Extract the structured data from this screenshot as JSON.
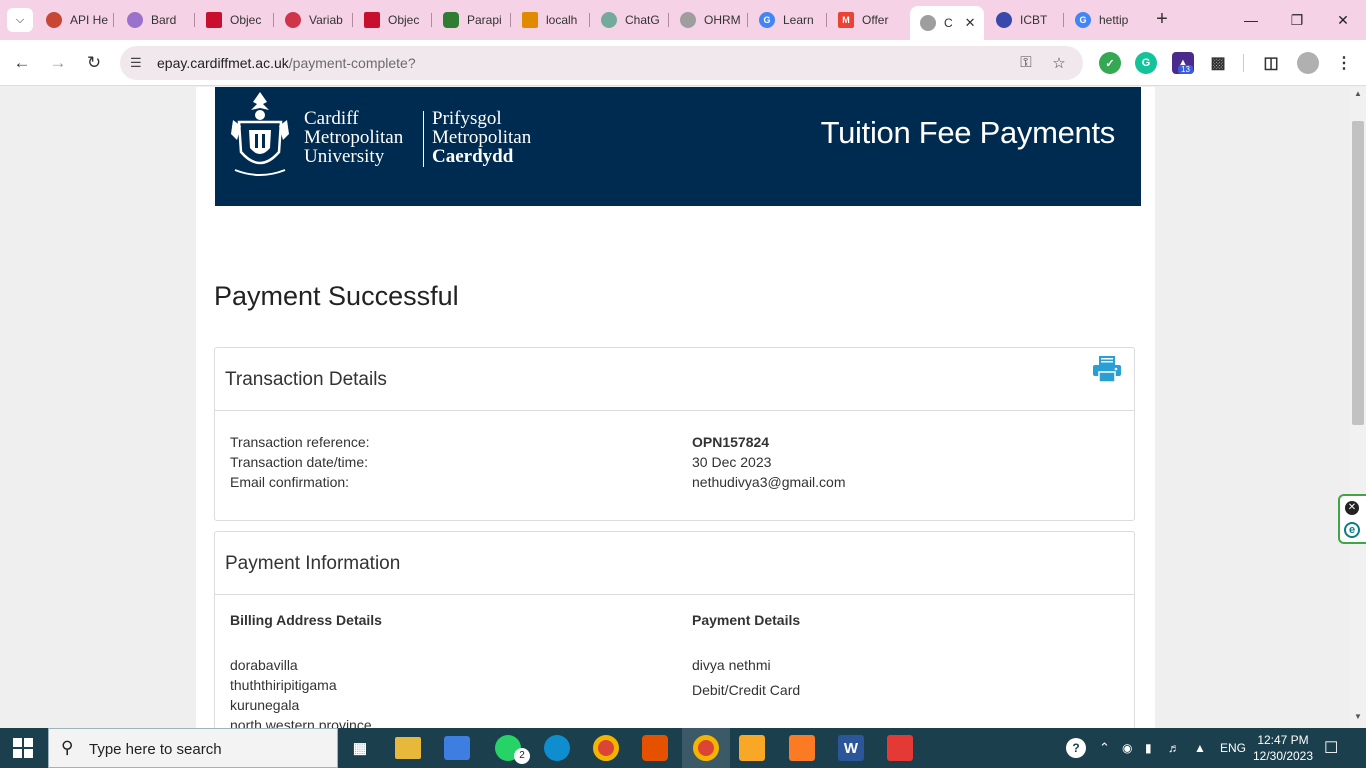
{
  "browser": {
    "tabs": [
      {
        "label": "API He",
        "icon": "oracle-icon",
        "color": "#c74634"
      },
      {
        "label": "Bard",
        "icon": "bard-icon",
        "color": "#9b72cb"
      },
      {
        "label": "Objec",
        "icon": "vuejs-icon",
        "color": "#c8102e"
      },
      {
        "label": "Variab",
        "icon": "target-icon",
        "color": "#d0344a"
      },
      {
        "label": "Objec",
        "icon": "vuejs-icon",
        "color": "#c8102e"
      },
      {
        "label": "Parapi",
        "icon": "robot-icon",
        "color": "#2e7d32"
      },
      {
        "label": "localh",
        "icon": "phpmyadmin-icon",
        "color": "#e08a00"
      },
      {
        "label": "ChatG",
        "icon": "chatgpt-icon",
        "color": "#74aa9c"
      },
      {
        "label": "OHRM",
        "icon": "globe-icon",
        "color": "#9e9e9e"
      },
      {
        "label": "Learn",
        "icon": "google-icon",
        "color": "#4285f4"
      },
      {
        "label": "Offer",
        "icon": "gmail-icon",
        "color": "#ea4335"
      },
      {
        "label": "C",
        "icon": "globe-icon",
        "color": "#9e9e9e",
        "active": true
      },
      {
        "label": "ICBT",
        "icon": "icbt-icon",
        "color": "#3949ab"
      },
      {
        "label": "hettip",
        "icon": "google-icon",
        "color": "#4285f4"
      }
    ],
    "address": {
      "domain": "epay.cardiffmet.ac.uk",
      "path": "/payment-complete?"
    },
    "extensions_badge": "13"
  },
  "page": {
    "university": {
      "en": [
        "Cardiff",
        "Metropolitan",
        "University"
      ],
      "cy": [
        "Prifysgol",
        "Metropolitan",
        "Caerdydd"
      ]
    },
    "banner_title": "Tuition Fee Payments",
    "heading": "Payment Successful",
    "transaction": {
      "title": "Transaction Details",
      "rows": [
        {
          "label": "Transaction reference:",
          "value": "OPN157824"
        },
        {
          "label": "Transaction date/time:",
          "value": "30 Dec 2023"
        },
        {
          "label": "Email confirmation:",
          "value": "nethudivya3@gmail.com"
        }
      ]
    },
    "payment": {
      "title": "Payment Information",
      "billing_heading": "Billing Address Details",
      "billing_lines": [
        "dorabavilla",
        "thuththiripitigama",
        "kurunegala",
        "north western province"
      ],
      "details_heading": "Payment Details",
      "name": "divya nethmi",
      "method": "Debit/Credit Card"
    }
  },
  "taskbar": {
    "search_placeholder": "Type here to search",
    "whatsapp_badge": "2",
    "language": "ENG",
    "time": "12:47 PM",
    "date": "12/30/2023"
  },
  "colors": {
    "banner": "#002b50",
    "tabstrip": "#f6d2e6",
    "print_icon": "#2a9fd6",
    "taskbar": "#1c3f4d"
  }
}
